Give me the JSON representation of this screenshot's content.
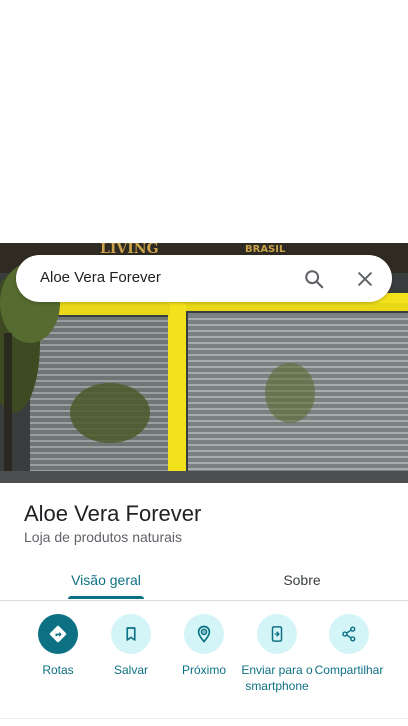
{
  "search": {
    "query": "Aloe Vera Forever"
  },
  "hero": {
    "sign_text_left": "LIVING",
    "sign_text_right": "BRASIL"
  },
  "place": {
    "name": "Aloe Vera Forever",
    "category": "Loja de produtos naturais"
  },
  "tabs": [
    {
      "label": "Visão geral",
      "selected": true
    },
    {
      "label": "Sobre",
      "selected": false
    }
  ],
  "actions": [
    {
      "label": "Rotas",
      "icon": "directions-icon"
    },
    {
      "label": "Salvar",
      "icon": "bookmark-icon"
    },
    {
      "label": "Próximo",
      "icon": "nearby-icon"
    },
    {
      "label": "Enviar para o smartphone",
      "icon": "send-to-phone-icon"
    },
    {
      "label": "Compartilhar",
      "icon": "share-icon"
    }
  ],
  "colors": {
    "accent": "#0e7183",
    "action_bg": "#d3f5f8",
    "storefront_yellow": "#f2e21b"
  }
}
